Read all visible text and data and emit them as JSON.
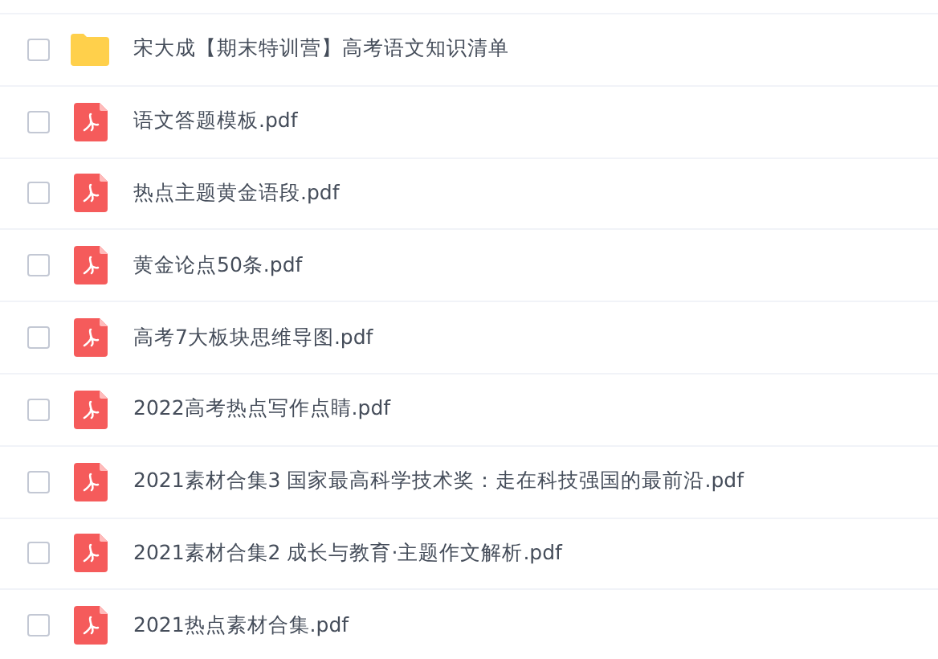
{
  "files": [
    {
      "kind": "folder",
      "name": "宋大成【期末特训营】高考语文知识清单",
      "checked": false
    },
    {
      "kind": "pdf",
      "name": "语文答题模板.pdf",
      "checked": false
    },
    {
      "kind": "pdf",
      "name": "热点主题黄金语段.pdf",
      "checked": false
    },
    {
      "kind": "pdf",
      "name": "黄金论点50条.pdf",
      "checked": false
    },
    {
      "kind": "pdf",
      "name": "高考7大板块思维导图.pdf",
      "checked": false
    },
    {
      "kind": "pdf",
      "name": "2022高考热点写作点睛.pdf",
      "checked": false
    },
    {
      "kind": "pdf",
      "name": "2021素材合集3 国家最高科学技术奖：走在科技强国的最前沿.pdf",
      "checked": false
    },
    {
      "kind": "pdf",
      "name": "2021素材合集2 成长与教育·主题作文解析.pdf",
      "checked": false
    },
    {
      "kind": "pdf",
      "name": "2021热点素材合集.pdf",
      "checked": false
    }
  ]
}
